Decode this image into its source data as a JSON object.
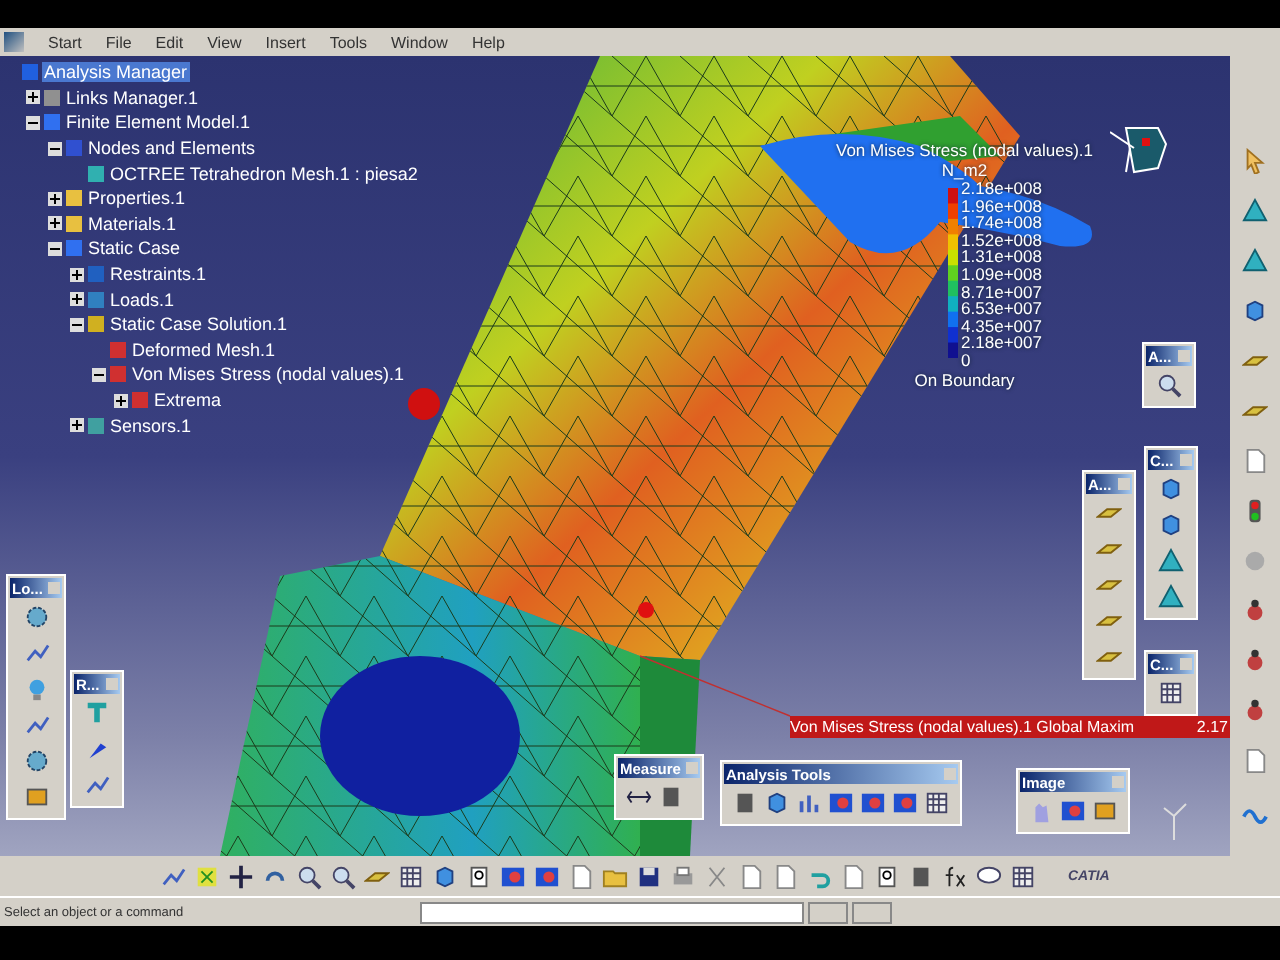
{
  "menu_bar": {
    "items": [
      {
        "label": "Start"
      },
      {
        "label": "File"
      },
      {
        "label": "Edit"
      },
      {
        "label": "View"
      },
      {
        "label": "Insert"
      },
      {
        "label": "Tools"
      },
      {
        "label": "Window"
      },
      {
        "label": "Help"
      }
    ]
  },
  "tree": [
    {
      "label": "Analysis Manager",
      "selected": true,
      "children": [
        {
          "label": "Links Manager.1",
          "expanded": false,
          "selected": false
        },
        {
          "label": "Finite Element Model.1",
          "expanded": true,
          "selected": false,
          "children": [
            {
              "label": "Nodes and Elements",
              "expanded": true,
              "selected": false,
              "children": [
                {
                  "label": "OCTREE Tetrahedron Mesh.1 : piesa2",
                  "selected": false
                }
              ]
            },
            {
              "label": "Properties.1",
              "expanded": false,
              "selected": false
            },
            {
              "label": "Materials.1",
              "expanded": false,
              "selected": false
            },
            {
              "label": "Static Case",
              "expanded": true,
              "selected": false,
              "children": [
                {
                  "label": "Restraints.1",
                  "expanded": false,
                  "selected": false
                },
                {
                  "label": "Loads.1",
                  "expanded": false,
                  "selected": false
                },
                {
                  "label": "Static Case Solution.1",
                  "expanded": true,
                  "selected": false,
                  "children": [
                    {
                      "label": "Deformed Mesh.1",
                      "selected": false
                    },
                    {
                      "label": "Von Mises Stress (nodal values).1",
                      "expanded": true,
                      "selected": false,
                      "children": [
                        {
                          "label": "Extrema",
                          "expanded": false,
                          "selected": false
                        }
                      ]
                    }
                  ]
                },
                {
                  "label": "Sensors.1",
                  "expanded": false,
                  "selected": false
                }
              ]
            }
          ]
        }
      ]
    }
  ],
  "legend": {
    "title": "Von Mises Stress (nodal values).1",
    "unit": "N_m2",
    "values": [
      "2.18e+008",
      "1.96e+008",
      "1.74e+008",
      "1.52e+008",
      "1.31e+008",
      "1.09e+008",
      "8.71e+007",
      "6.53e+007",
      "4.35e+007",
      "2.18e+007",
      "0"
    ],
    "footer": "On Boundary"
  },
  "annotation": {
    "label": "Von Mises Stress (nodal values).1  Global Maxim",
    "value": "2.17"
  },
  "toolbars": [
    {
      "title": "Lo...",
      "kind": "vertical"
    },
    {
      "title": "R...",
      "kind": "vertical"
    },
    {
      "title": "Measure",
      "kind": "horizontal"
    },
    {
      "title": "Analysis Tools",
      "kind": "horizontal"
    },
    {
      "title": "Image",
      "kind": "horizontal"
    },
    {
      "title": "A...",
      "kind": "vertical"
    },
    {
      "title": "A...",
      "kind": "vertical"
    },
    {
      "title": "C...",
      "kind": "vertical"
    },
    {
      "title": "C...",
      "kind": "vertical"
    }
  ],
  "bottom_toolbar": {
    "logo": "CATIA"
  },
  "status_bar": {
    "text": "Select an object or a command"
  }
}
